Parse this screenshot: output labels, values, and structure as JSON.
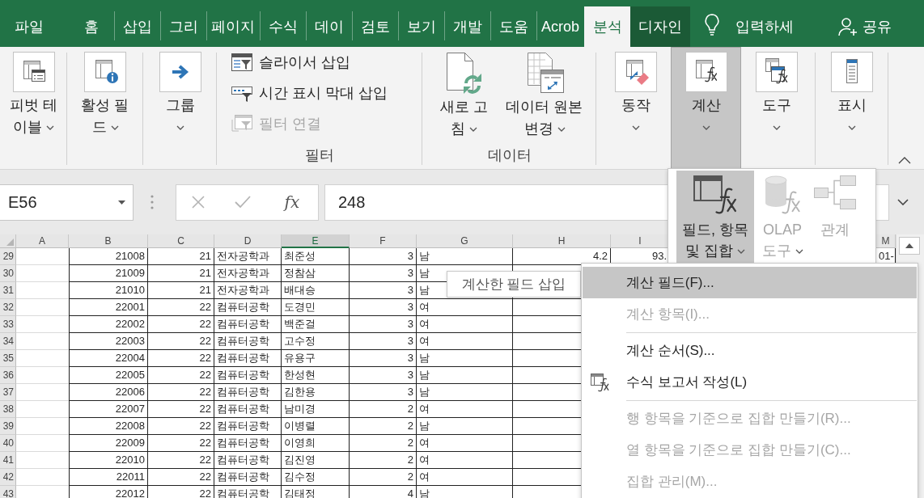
{
  "tabs": [
    {
      "label": "파일",
      "selected": false,
      "contextual": false
    },
    {
      "label": "홈",
      "selected": false,
      "contextual": false
    },
    {
      "label": "삽입",
      "selected": false,
      "contextual": false
    },
    {
      "label": "그리",
      "selected": false,
      "contextual": false
    },
    {
      "label": "페이지",
      "selected": false,
      "contextual": false
    },
    {
      "label": "수식",
      "selected": false,
      "contextual": false
    },
    {
      "label": "데이",
      "selected": false,
      "contextual": false
    },
    {
      "label": "검토",
      "selected": false,
      "contextual": false
    },
    {
      "label": "보기",
      "selected": false,
      "contextual": false
    },
    {
      "label": "개발",
      "selected": false,
      "contextual": false
    },
    {
      "label": "도움",
      "selected": false,
      "contextual": false
    },
    {
      "label": "Acrob",
      "selected": false,
      "contextual": false
    },
    {
      "label": "분석",
      "selected": true,
      "contextual": false
    },
    {
      "label": "디자인",
      "selected": false,
      "contextual": true
    }
  ],
  "tell_me": {
    "placeholder": "입력하세"
  },
  "share": {
    "label": "공유"
  },
  "ribbon": {
    "groups": [
      {
        "buttons": [
          {
            "label": "피벗 테이블",
            "dropdown": true,
            "pressed": false
          }
        ]
      },
      {
        "buttons": [
          {
            "label": "활성 필드",
            "dropdown": true,
            "pressed": false
          }
        ]
      },
      {
        "buttons": [
          {
            "label": "그룹",
            "dropdown": true,
            "pressed": false
          }
        ]
      },
      {
        "label": "필터",
        "small_buttons": [
          {
            "label": "슬라이서 삽입",
            "disabled": false
          },
          {
            "label": "시간 표시 막대 삽입",
            "disabled": false
          },
          {
            "label": "필터 연결",
            "disabled": true
          }
        ]
      },
      {
        "label": "데이터",
        "buttons": [
          {
            "label": "새로 고침",
            "dropdown": true,
            "pressed": false
          },
          {
            "label": "데이터 원본 변경",
            "dropdown": true,
            "pressed": false
          }
        ]
      },
      {
        "buttons": [
          {
            "label": "동작",
            "dropdown": true,
            "pressed": false
          },
          {
            "label": "계산",
            "dropdown": true,
            "pressed": true
          },
          {
            "label": "도구",
            "dropdown": true,
            "pressed": false
          }
        ]
      },
      {
        "buttons": [
          {
            "label": "표시",
            "dropdown": true,
            "pressed": false
          }
        ]
      }
    ]
  },
  "formula_bar": {
    "name_box": "E56",
    "function_button": "fx",
    "value": "248"
  },
  "sheet": {
    "columns": [
      {
        "label": "A",
        "selected": false
      },
      {
        "label": "B",
        "selected": false
      },
      {
        "label": "C",
        "selected": false
      },
      {
        "label": "D",
        "selected": false
      },
      {
        "label": "E",
        "selected": true
      },
      {
        "label": "F",
        "selected": false
      },
      {
        "label": "G",
        "selected": false
      },
      {
        "label": "H",
        "selected": false
      },
      {
        "label": "I",
        "selected": false
      },
      {
        "label": "M",
        "selected": false
      }
    ],
    "rows": [
      {
        "number": "29",
        "cells": [
          null,
          "21008",
          "21",
          "전자공학과",
          "최준성",
          "3",
          "남",
          "4.2",
          "93.",
          "01-"
        ]
      },
      {
        "number": "30",
        "cells": [
          null,
          "21009",
          "21",
          "전자공학과",
          "정참삼",
          "3",
          "남"
        ]
      },
      {
        "number": "31",
        "cells": [
          null,
          "21010",
          "21",
          "전자공학과",
          "배대승",
          "3",
          "남"
        ]
      },
      {
        "number": "32",
        "cells": [
          null,
          "22001",
          "22",
          "컴퓨터공학",
          "도경민",
          "3",
          "여"
        ]
      },
      {
        "number": "33",
        "cells": [
          null,
          "22002",
          "22",
          "컴퓨터공학",
          "백준걸",
          "3",
          "여"
        ]
      },
      {
        "number": "34",
        "cells": [
          null,
          "22003",
          "22",
          "컴퓨터공학",
          "고수정",
          "3",
          "여"
        ]
      },
      {
        "number": "35",
        "cells": [
          null,
          "22004",
          "22",
          "컴퓨터공학",
          "유용구",
          "3",
          "남"
        ]
      },
      {
        "number": "36",
        "cells": [
          null,
          "22005",
          "22",
          "컴퓨터공학",
          "한성현",
          "3",
          "남"
        ]
      },
      {
        "number": "37",
        "cells": [
          null,
          "22006",
          "22",
          "컴퓨터공학",
          "김한용",
          "3",
          "남"
        ]
      },
      {
        "number": "38",
        "cells": [
          null,
          "22007",
          "22",
          "컴퓨터공학",
          "남미경",
          "2",
          "여"
        ]
      },
      {
        "number": "39",
        "cells": [
          null,
          "22008",
          "22",
          "컴퓨터공학",
          "이병렬",
          "2",
          "남"
        ]
      },
      {
        "number": "40",
        "cells": [
          null,
          "22009",
          "22",
          "컴퓨터공학",
          "이영희",
          "2",
          "여"
        ]
      },
      {
        "number": "41",
        "cells": [
          null,
          "22010",
          "22",
          "컴퓨터공학",
          "김진영",
          "2",
          "여"
        ]
      },
      {
        "number": "42",
        "cells": [
          null,
          "22011",
          "22",
          "컴퓨터공학",
          "김수정",
          "2",
          "여"
        ]
      },
      {
        "number": "43",
        "cells": [
          null,
          "22012",
          "22",
          "컴퓨터공학",
          "김태정",
          "4",
          "남"
        ]
      }
    ]
  },
  "calculations_dropdown": {
    "buttons": [
      {
        "label": "필드, 항목 및 집합",
        "dropdown": true,
        "selected": true,
        "disabled": false
      },
      {
        "label": "OLAP 도구",
        "dropdown": true,
        "selected": false,
        "disabled": true
      },
      {
        "label": "관계",
        "dropdown": false,
        "selected": false,
        "disabled": true
      }
    ]
  },
  "tooltip": {
    "text": "계산한 필드 삽입"
  },
  "context_menu": {
    "items": [
      {
        "kind": "item",
        "label": "계산 필드(F)...",
        "selected": true,
        "disabled": false
      },
      {
        "kind": "item",
        "label": "계산 항목(I)...",
        "selected": false,
        "disabled": true
      },
      {
        "kind": "separator"
      },
      {
        "kind": "item",
        "label": "계산 순서(S)...",
        "selected": false,
        "disabled": false
      },
      {
        "kind": "item",
        "label": "수식 보고서 작성(L)",
        "selected": false,
        "disabled": false
      },
      {
        "kind": "separator"
      },
      {
        "kind": "item",
        "label": "행 항목을 기준으로 집합 만들기(R)...",
        "selected": false,
        "disabled": true
      },
      {
        "kind": "item",
        "label": "열 항목을 기준으로 집합 만들기(C)...",
        "selected": false,
        "disabled": true
      },
      {
        "kind": "item",
        "label": "집합 관리(M)...",
        "selected": false,
        "disabled": true
      }
    ]
  }
}
